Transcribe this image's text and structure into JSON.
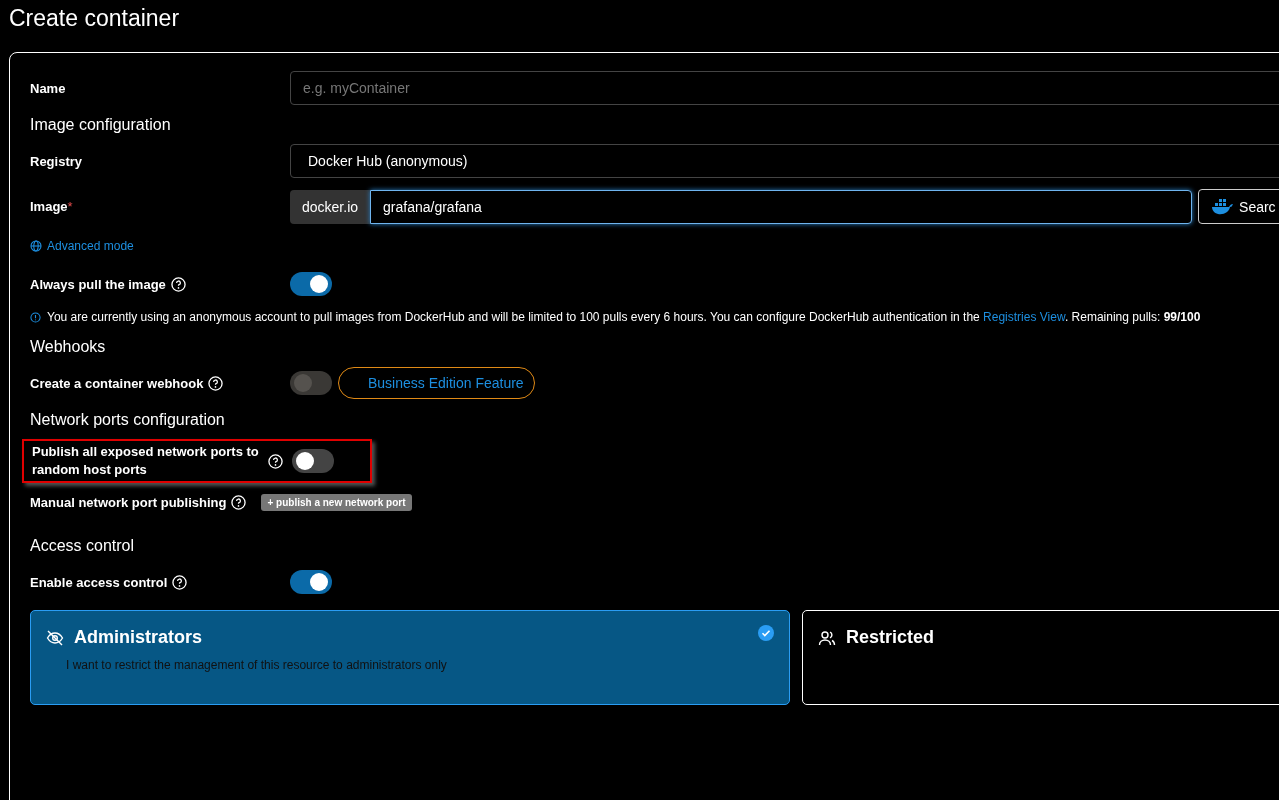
{
  "page_title": "Create container",
  "name_field": {
    "label": "Name",
    "placeholder": "e.g. myContainer"
  },
  "image_section": {
    "heading": "Image configuration",
    "registry": {
      "label": "Registry",
      "value": "Docker Hub (anonymous)"
    },
    "image": {
      "label": "Image",
      "required_mark": "*",
      "prefix": "docker.io",
      "value": "grafana/grafana",
      "search_button": "Searc"
    },
    "advanced_link": "Advanced mode",
    "always_pull": {
      "label": "Always pull the image",
      "on": true,
      "disabled": false
    },
    "info": {
      "text": "You are currently using an anonymous account to pull images from DockerHub and will be limited to 100 pulls every 6 hours. You can configure DockerHub authentication in the",
      "link": "Registries View",
      "suffix": ". Remaining pulls: **99/100**"
    }
  },
  "webhooks": {
    "heading": "Webhooks",
    "toggle": {
      "label": "Create a container webhook",
      "on": false,
      "disabled": true
    },
    "badge": "Business Edition Feature"
  },
  "network": {
    "heading": "Network ports configuration",
    "publish_all": {
      "label": "Publish all exposed network ports to random host ports",
      "on": false,
      "disabled": false,
      "highlighted": true
    },
    "manual": {
      "label": "Manual network port publishing",
      "button": "+ publish a new network port"
    }
  },
  "access": {
    "heading": "Access control",
    "toggle": {
      "label": "Enable access control",
      "on": true,
      "disabled": false
    },
    "options": [
      {
        "kind": "admin",
        "title": "Administrators",
        "description": "I want to restrict the management of this resource to administrators only",
        "selected": true
      },
      {
        "kind": "restricted",
        "title": "Restricted",
        "selected": false
      }
    ]
  }
}
